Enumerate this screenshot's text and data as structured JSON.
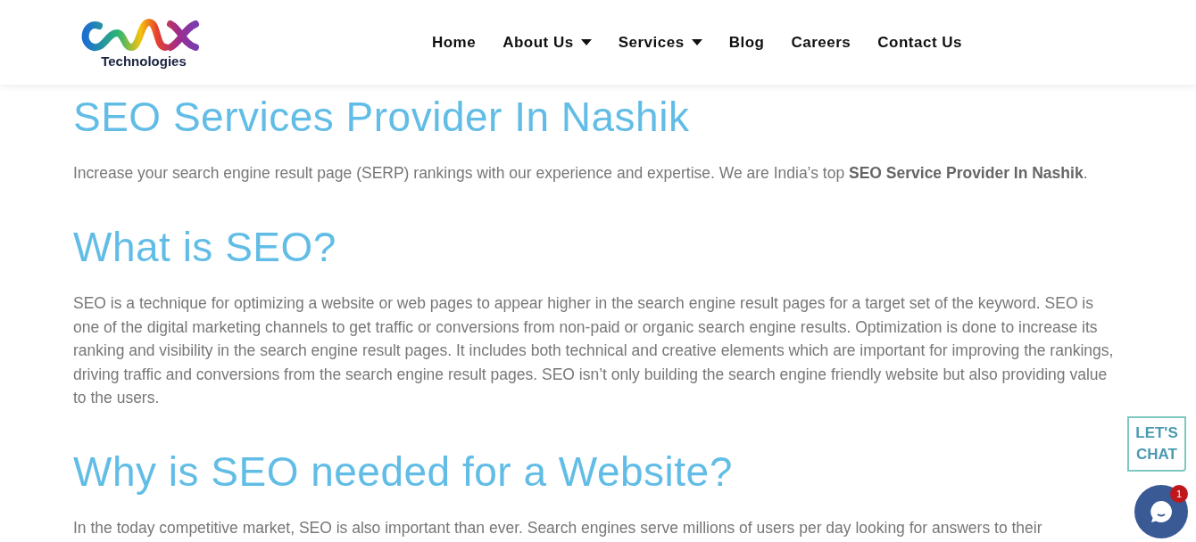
{
  "header": {
    "logo_text": "Technologies",
    "nav": [
      {
        "label": "Home",
        "has_menu": false
      },
      {
        "label": "About Us",
        "has_menu": true
      },
      {
        "label": "Services",
        "has_menu": true
      },
      {
        "label": "Blog",
        "has_menu": false
      },
      {
        "label": "Careers",
        "has_menu": false
      },
      {
        "label": "Contact Us",
        "has_menu": false
      }
    ]
  },
  "sections": [
    {
      "heading": "SEO Services Provider In Nashik",
      "text": "Increase your search engine result page (SERP) rankings with our experience and expertise. We are India’s top **SEO Service Provider In Nashik**."
    },
    {
      "heading": "What is SEO?",
      "text": "SEO is a technique for optimizing a website or web pages to appear higher in the search engine result pages for a target set of the keyword. SEO is one of the digital marketing channels to get traffic or conversions from non-paid or organic search engine results. Optimization is done to increase its ranking and visibility in the search engine result pages. It includes both technical and creative elements which are important for improving the rankings, driving traffic and conversions from the search engine result pages. SEO isn’t only building the search engine friendly website but also providing value to the users."
    },
    {
      "heading": "Why is SEO needed for a Website?",
      "text": "In the today competitive market, SEO is also important than ever. Search engines serve millions of users per day looking for answers to their"
    }
  ],
  "chat": {
    "sign_lines": [
      "LET'S",
      "CHAT"
    ],
    "badge": "1"
  }
}
